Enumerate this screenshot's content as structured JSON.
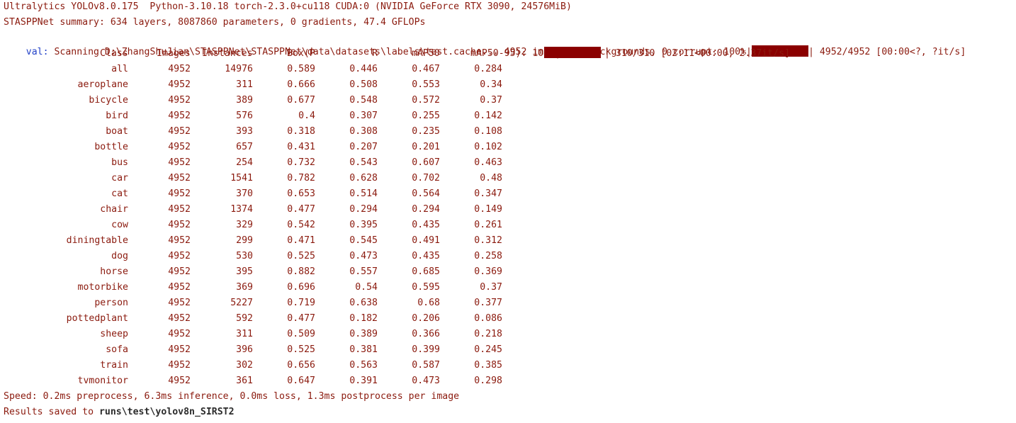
{
  "header_lines": {
    "env": "Ultralytics YOLOv8.0.175  Python-3.10.18 torch-2.3.0+cu118 CUDA:0 (NVIDIA GeForce RTX 3090, 24576MiB)",
    "summary": "STASPPNet summary: 634 layers, 8087860 parameters, 0 gradients, 47.4 GFLOPs",
    "val_prefix": "val:",
    "val_text": " Scanning D:\\ZhangShuJian\\STASPPNet\\STASPPNet\\data\\datasets\\labels\\test.cache... 4952 images, 0 backgrounds, 0 corrupt: 100%|",
    "val_tail": "| 4952/4952 [00:00<?, ?it/s]",
    "val_progress": 1.0
  },
  "table": {
    "columns": {
      "class": "Class",
      "images": "Images",
      "instances": "Instances",
      "box_p": "Box(P",
      "r": "R",
      "map50": "mAP50",
      "map5095": "mAP50-95): 100%|"
    },
    "progress_tail": "| 310/310 [02:11<00:00,  2.37it/s]",
    "progress": 1.0,
    "rows": [
      {
        "class": "all",
        "images": "4952",
        "instances": "14976",
        "p": "0.589",
        "r": "0.446",
        "map50": "0.467",
        "map5095": "0.284"
      },
      {
        "class": "aeroplane",
        "images": "4952",
        "instances": "311",
        "p": "0.666",
        "r": "0.508",
        "map50": "0.553",
        "map5095": "0.34"
      },
      {
        "class": "bicycle",
        "images": "4952",
        "instances": "389",
        "p": "0.677",
        "r": "0.548",
        "map50": "0.572",
        "map5095": "0.37"
      },
      {
        "class": "bird",
        "images": "4952",
        "instances": "576",
        "p": "0.4",
        "r": "0.307",
        "map50": "0.255",
        "map5095": "0.142"
      },
      {
        "class": "boat",
        "images": "4952",
        "instances": "393",
        "p": "0.318",
        "r": "0.308",
        "map50": "0.235",
        "map5095": "0.108"
      },
      {
        "class": "bottle",
        "images": "4952",
        "instances": "657",
        "p": "0.431",
        "r": "0.207",
        "map50": "0.201",
        "map5095": "0.102"
      },
      {
        "class": "bus",
        "images": "4952",
        "instances": "254",
        "p": "0.732",
        "r": "0.543",
        "map50": "0.607",
        "map5095": "0.463"
      },
      {
        "class": "car",
        "images": "4952",
        "instances": "1541",
        "p": "0.782",
        "r": "0.628",
        "map50": "0.702",
        "map5095": "0.48"
      },
      {
        "class": "cat",
        "images": "4952",
        "instances": "370",
        "p": "0.653",
        "r": "0.514",
        "map50": "0.564",
        "map5095": "0.347"
      },
      {
        "class": "chair",
        "images": "4952",
        "instances": "1374",
        "p": "0.477",
        "r": "0.294",
        "map50": "0.294",
        "map5095": "0.149"
      },
      {
        "class": "cow",
        "images": "4952",
        "instances": "329",
        "p": "0.542",
        "r": "0.395",
        "map50": "0.435",
        "map5095": "0.261"
      },
      {
        "class": "diningtable",
        "images": "4952",
        "instances": "299",
        "p": "0.471",
        "r": "0.545",
        "map50": "0.491",
        "map5095": "0.312"
      },
      {
        "class": "dog",
        "images": "4952",
        "instances": "530",
        "p": "0.525",
        "r": "0.473",
        "map50": "0.435",
        "map5095": "0.258"
      },
      {
        "class": "horse",
        "images": "4952",
        "instances": "395",
        "p": "0.882",
        "r": "0.557",
        "map50": "0.685",
        "map5095": "0.369"
      },
      {
        "class": "motorbike",
        "images": "4952",
        "instances": "369",
        "p": "0.696",
        "r": "0.54",
        "map50": "0.595",
        "map5095": "0.37"
      },
      {
        "class": "person",
        "images": "4952",
        "instances": "5227",
        "p": "0.719",
        "r": "0.638",
        "map50": "0.68",
        "map5095": "0.377"
      },
      {
        "class": "pottedplant",
        "images": "4952",
        "instances": "592",
        "p": "0.477",
        "r": "0.182",
        "map50": "0.206",
        "map5095": "0.086"
      },
      {
        "class": "sheep",
        "images": "4952",
        "instances": "311",
        "p": "0.509",
        "r": "0.389",
        "map50": "0.366",
        "map5095": "0.218"
      },
      {
        "class": "sofa",
        "images": "4952",
        "instances": "396",
        "p": "0.525",
        "r": "0.381",
        "map50": "0.399",
        "map5095": "0.245"
      },
      {
        "class": "train",
        "images": "4952",
        "instances": "302",
        "p": "0.656",
        "r": "0.563",
        "map50": "0.587",
        "map5095": "0.385"
      },
      {
        "class": "tvmonitor",
        "images": "4952",
        "instances": "361",
        "p": "0.647",
        "r": "0.391",
        "map50": "0.473",
        "map5095": "0.298"
      }
    ]
  },
  "footer": {
    "speed": "Speed: 0.2ms preprocess, 6.3ms inference, 0.0ms loss, 1.3ms postprocess per image",
    "results_prefix": "Results saved to ",
    "results_path": "runs\\test\\yolov8n_SIRST2"
  },
  "colors": {
    "text": "#8b1a0e",
    "val_prefix": "#2342c8",
    "progress_bar": "#8b0000",
    "background": "#ffffff"
  }
}
